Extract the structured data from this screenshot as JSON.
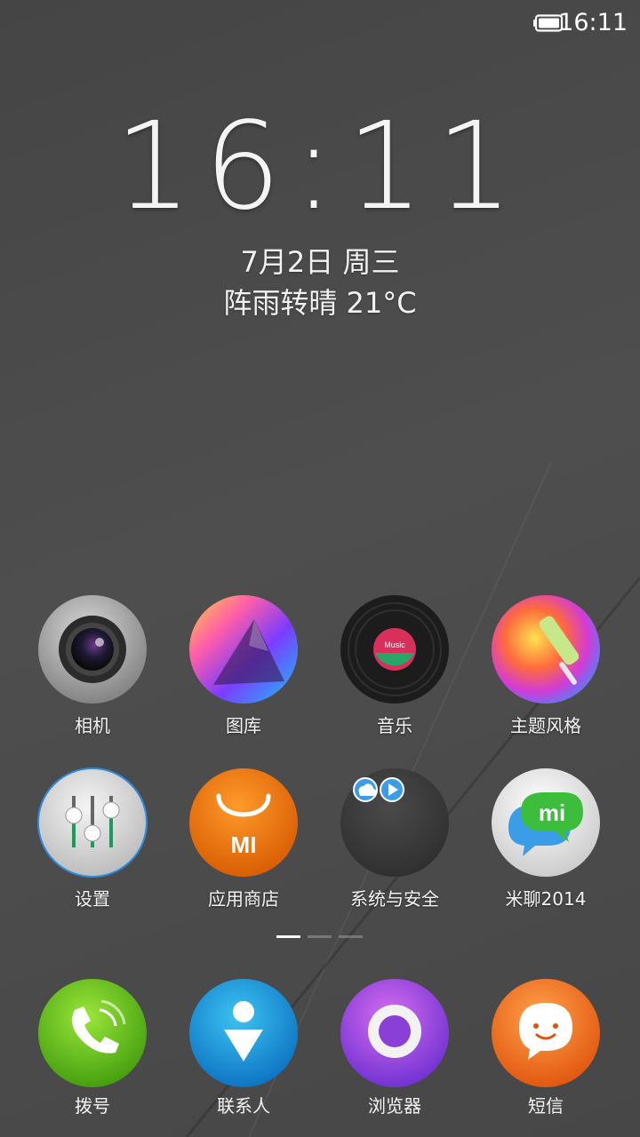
{
  "status_bar": {
    "time": "16:11",
    "battery_icon": "battery-icon"
  },
  "lockclock": {
    "time": "16:11",
    "date": "7月2日 周三",
    "weather": "阵雨转晴 21°C"
  },
  "apps_row1": [
    {
      "label": "相机",
      "icon": "camera-icon"
    },
    {
      "label": "图库",
      "icon": "gallery-icon"
    },
    {
      "label": "音乐",
      "icon": "music-icon",
      "record_label": "Music"
    },
    {
      "label": "主题风格",
      "icon": "theme-icon"
    }
  ],
  "apps_row2": [
    {
      "label": "设置",
      "icon": "settings-icon"
    },
    {
      "label": "应用商店",
      "icon": "app-store-icon",
      "badge_text": "MI"
    },
    {
      "label": "系统与安全",
      "icon": "system-security-folder-icon"
    },
    {
      "label": "米聊2014",
      "icon": "miliao-icon",
      "badge_text": "mi"
    }
  ],
  "page_indicator": {
    "pages": 3,
    "current": 1
  },
  "dock": [
    {
      "label": "拨号",
      "icon": "phone-icon"
    },
    {
      "label": "联系人",
      "icon": "contacts-icon"
    },
    {
      "label": "浏览器",
      "icon": "browser-icon"
    },
    {
      "label": "短信",
      "icon": "messaging-icon"
    }
  ],
  "colors": {
    "background": "#4a4a4a",
    "text": "#ffffff"
  }
}
